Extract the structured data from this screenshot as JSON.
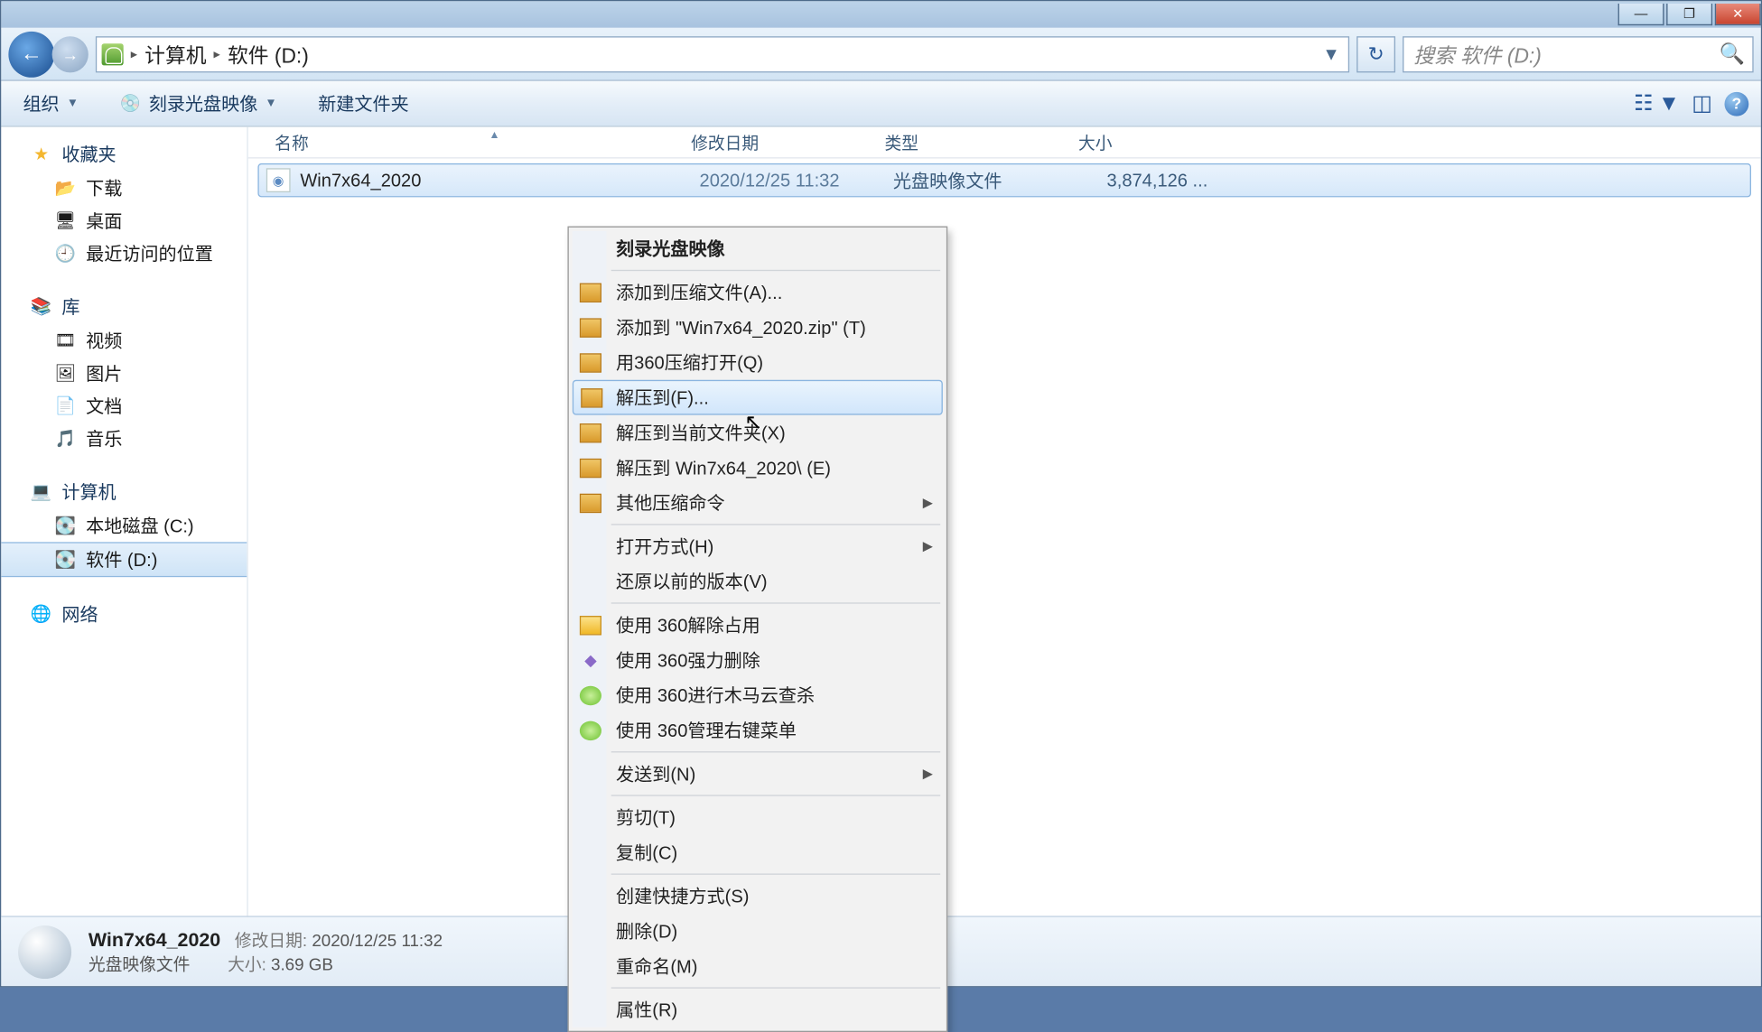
{
  "titlebar": {
    "min": "—",
    "max": "❐",
    "close": "✕"
  },
  "nav": {
    "breadcrumb": [
      "计算机",
      "软件 (D:)"
    ],
    "refresh": "↻",
    "search_placeholder": "搜索 软件 (D:)"
  },
  "toolbar": {
    "organize": "组织",
    "burn": "刻录光盘映像",
    "newfolder": "新建文件夹"
  },
  "sidebar": {
    "favorites": {
      "head": "收藏夹",
      "items": [
        "下载",
        "桌面",
        "最近访问的位置"
      ]
    },
    "libraries": {
      "head": "库",
      "items": [
        "视频",
        "图片",
        "文档",
        "音乐"
      ]
    },
    "computer": {
      "head": "计算机",
      "items": [
        "本地磁盘 (C:)",
        "软件 (D:)"
      ]
    },
    "network": {
      "head": "网络"
    }
  },
  "columns": {
    "name": "名称",
    "date": "修改日期",
    "type": "类型",
    "size": "大小"
  },
  "file": {
    "name": "Win7x64_2020",
    "date": "2020/12/25 11:32",
    "type": "光盘映像文件",
    "size": "3,874,126 ..."
  },
  "context_menu": {
    "burn": "刻录光盘映像",
    "add_to_archive": "添加到压缩文件(A)...",
    "add_to_zip": "添加到 \"Win7x64_2020.zip\" (T)",
    "open_360zip": "用360压缩打开(Q)",
    "extract_to": "解压到(F)...",
    "extract_here": "解压到当前文件夹(X)",
    "extract_named": "解压到 Win7x64_2020\\ (E)",
    "other_zip": "其他压缩命令",
    "open_with": "打开方式(H)",
    "restore_prev": "还原以前的版本(V)",
    "unlock_360": "使用 360解除占用",
    "forcedel_360": "使用 360强力删除",
    "scan_360": "使用 360进行木马云查杀",
    "menu_360": "使用 360管理右键菜单",
    "send_to": "发送到(N)",
    "cut": "剪切(T)",
    "copy": "复制(C)",
    "shortcut": "创建快捷方式(S)",
    "delete": "删除(D)",
    "rename": "重命名(M)",
    "properties": "属性(R)"
  },
  "status": {
    "name": "Win7x64_2020",
    "type": "光盘映像文件",
    "date_label": "修改日期:",
    "date": "2020/12/25 11:32",
    "size_label": "大小:",
    "size": "3.69 GB"
  }
}
